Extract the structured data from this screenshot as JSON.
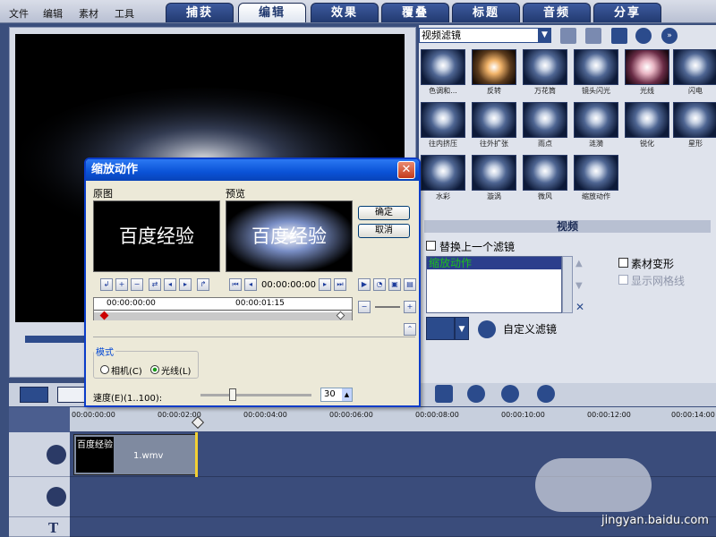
{
  "menu": [
    "文件",
    "编辑",
    "素材",
    "工具"
  ],
  "tabs": [
    "捕获",
    "编辑",
    "效果",
    "覆叠",
    "标题",
    "音频",
    "分享"
  ],
  "filter_category": "视频滤镜",
  "filters": [
    "色调和...",
    "反转",
    "万花筒",
    "镜头闪光",
    "光线",
    "闪电",
    "往内挤压",
    "往外扩张",
    "雨点",
    "涟漪",
    "锐化",
    "星形",
    "水彩",
    "漩涡",
    "微风",
    "缩放动作"
  ],
  "video_panel": {
    "header": "视频",
    "replace_last": "替换上一个滤镜",
    "applied_filter": "缩放动作",
    "clip_transform": "素材变形",
    "show_grid": "显示网格线",
    "custom_filter": "自定义滤镜"
  },
  "dialog": {
    "title": "缩放动作",
    "close": "✕",
    "original": "原图",
    "preview": "预览",
    "ok": "确定",
    "cancel": "取消",
    "screen_text": "百度经验",
    "timecode": "00:00:00:00",
    "ruler_start": "00:00:00:00",
    "ruler_mid": "00:00:01:15",
    "mode_label": "模式",
    "camera": "相机(C)",
    "light": "光线(L)",
    "speed_label": "速度(E)(1..100):",
    "speed_value": "30"
  },
  "timeline": {
    "ticks": [
      "00:00:00:00",
      "00:00:02:00",
      "00:00:04:00",
      "00:00:06:00",
      "00:00:08:00",
      "00:00:10:00",
      "00:00:12:00",
      "00:00:14:00"
    ],
    "clip_label": "1.wmv",
    "clip_thumb_text": "百度经验"
  },
  "watermark": {
    "text": "jingyan.baidu.com"
  },
  "colors": {
    "accent": "#0a52d6",
    "list_text": "#1cc11c"
  }
}
